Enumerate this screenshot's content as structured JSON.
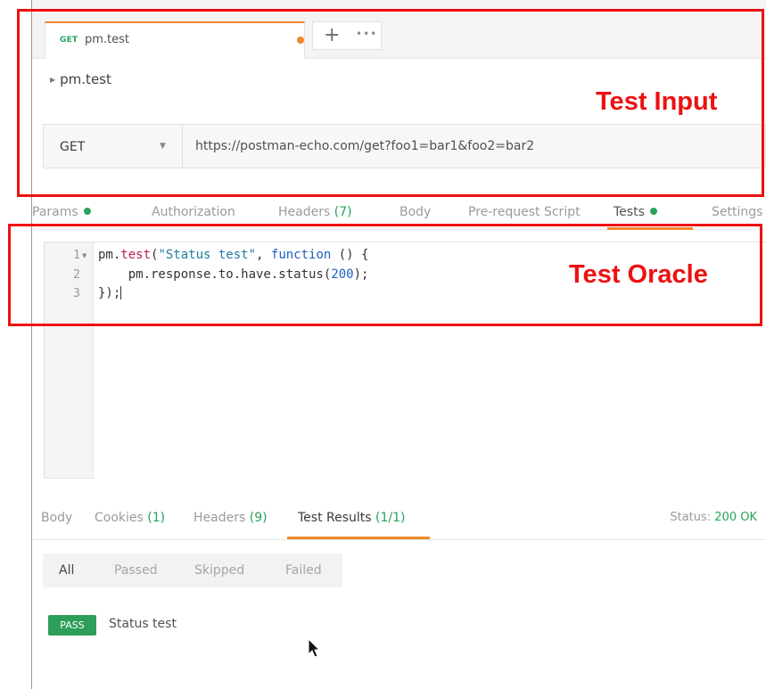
{
  "request_tab": {
    "method": "GET",
    "name": "pm.test"
  },
  "tab_actions": {
    "add": "+",
    "more": "•••"
  },
  "breadcrumb": {
    "title": "pm.test"
  },
  "url_bar": {
    "method": "GET",
    "url": "https://postman-echo.com/get?foo1=bar1&foo2=bar2"
  },
  "request_tabs": [
    {
      "label": "Params"
    },
    {
      "label": "Authorization"
    },
    {
      "label": "Headers",
      "count": "(7)"
    },
    {
      "label": "Body"
    },
    {
      "label": "Pre-request Script"
    },
    {
      "label": "Tests"
    },
    {
      "label": "Settings"
    }
  ],
  "editor": {
    "line_numbers": [
      "1",
      "2",
      "3"
    ],
    "lines": [
      {
        "t1": "pm.",
        "t2": "test",
        "t3": "(",
        "t4": "\"Status test\"",
        "t5": ", ",
        "t6": "function",
        "t7": " () {"
      },
      {
        "t1": "    pm.response.to.have.status(",
        "t2": "200",
        "t3": ");"
      },
      {
        "t1": "});"
      }
    ]
  },
  "response_tabs": [
    {
      "label": "Body"
    },
    {
      "label": "Cookies",
      "count": "(1)"
    },
    {
      "label": "Headers",
      "count": "(9)"
    },
    {
      "label": "Test Results",
      "count": "(1/1)"
    }
  ],
  "status": {
    "label": "Status:",
    "value": "200 OK"
  },
  "filters": [
    "All",
    "Passed",
    "Skipped",
    "Failed"
  ],
  "result": {
    "badge": "PASS",
    "name": "Status test"
  },
  "annotations": {
    "input_label": "Test Input",
    "oracle_label": "Test Oracle"
  },
  "colors": {
    "accent": "#f0892b",
    "success": "#26a25c",
    "annotation": "#ee1111"
  }
}
